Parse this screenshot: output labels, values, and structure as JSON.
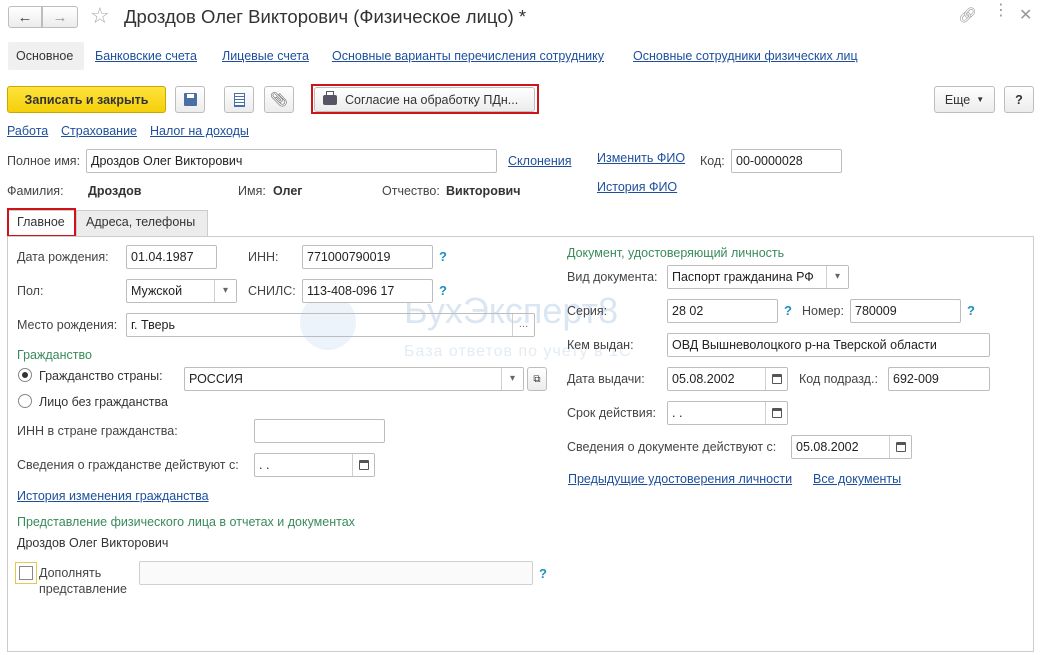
{
  "window": {
    "title": "Дроздов Олег Викторович (Физическое лицо) *",
    "back_icon": "arrow-left-icon",
    "forward_icon": "arrow-right-icon",
    "star_icon": "star-icon",
    "link_icon": "link-icon",
    "more_icon": "vertical-dots-icon",
    "close_icon": "close-icon"
  },
  "nav_tabs": [
    "Основное",
    "Банковские счета",
    "Лицевые счета",
    "Основные варианты перечисления сотруднику",
    "Основные сотрудники физических лиц"
  ],
  "toolbar": {
    "save_close": "Записать и закрыть",
    "print_label": "Согласие на обработку ПДн...",
    "more": "Еще",
    "help": "?"
  },
  "sub_links": [
    "Работа",
    "Страхование",
    "Налог на доходы"
  ],
  "header": {
    "full_name_label": "Полное имя:",
    "full_name_value": "Дроздов Олег Викторович",
    "declensions": "Склонения",
    "change_fio": "Изменить ФИО",
    "code_label": "Код:",
    "code_value": "00-0000028",
    "surname_label": "Фамилия:",
    "surname_value": "Дроздов",
    "name_label": "Имя:",
    "name_value": "Олег",
    "patronymic_label": "Отчество:",
    "patronymic_value": "Викторович",
    "fio_history": "История ФИО"
  },
  "inner_tabs": [
    "Главное",
    "Адреса, телефоны"
  ],
  "left": {
    "birth_date_label": "Дата рождения:",
    "birth_date": "01.04.1987",
    "inn_label": "ИНН:",
    "inn": "771000790019",
    "gender_label": "Пол:",
    "gender": "Мужской",
    "snils_label": "СНИЛС:",
    "snils": "113-408-096 17",
    "birth_place_label": "Место рождения:",
    "birth_place": "г. Тверь",
    "citizenship_header": "Гражданство",
    "citizenship_country_label": "Гражданство страны:",
    "citizenship_country": "РОССИЯ",
    "stateless_label": "Лицо без гражданства",
    "inn_foreign_label": "ИНН в стране гражданства:",
    "citizenship_from_label": "Сведения о гражданстве действуют с:",
    "citizenship_from": " .  .",
    "citizenship_history": "История изменения гражданства",
    "representation_header": "Представление физического лица в отчетах и документах",
    "representation_value": "Дроздов Олег Викторович",
    "supplement_label_1": "Дополнять",
    "supplement_label_2": "представление",
    "help": "?"
  },
  "right": {
    "doc_header": "Документ, удостоверяющий личность",
    "doc_type_label": "Вид документа:",
    "doc_type": "Паспорт гражданина РФ",
    "series_label": "Серия:",
    "series": "28 02",
    "number_label": "Номер:",
    "number": "780009",
    "issued_by_label": "Кем выдан:",
    "issued_by": "ОВД Вышневолоцкого р-на Тверской области",
    "issue_date_label": "Дата выдачи:",
    "issue_date": "05.08.2002",
    "dept_code_label": "Код подразд.:",
    "dept_code": "692-009",
    "validity_label": "Срок действия:",
    "validity": " .  .",
    "doc_valid_from_label": "Сведения о документе действуют с:",
    "doc_valid_from": "05.08.2002",
    "prev_docs": "Предыдущие удостоверения личности",
    "all_docs": "Все документы"
  },
  "watermark": {
    "title": "БухЭксперт8",
    "subtitle": "База ответов по учету в 1С"
  }
}
